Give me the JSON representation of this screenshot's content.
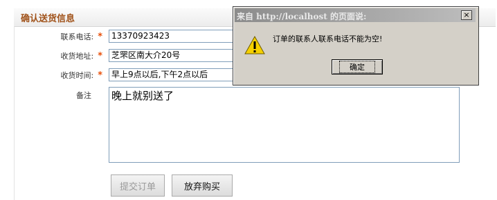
{
  "header": {
    "title": "确认送货信息"
  },
  "form": {
    "phone": {
      "label": "联系电话:",
      "required_mark": "*",
      "value": "13370923423"
    },
    "address": {
      "label": "收货地址:",
      "required_mark": "*",
      "value": "芝罘区南大介20号"
    },
    "delivery_time": {
      "label": "收货时间:",
      "required_mark": "*",
      "value": "早上9点以后,下午2点以后"
    },
    "notes": {
      "label": "备注",
      "value": "晚上就别送了"
    }
  },
  "buttons": {
    "submit_label": "提交订单",
    "cancel_label": "放弃购买"
  },
  "dialog": {
    "title": "来自 http://localhost 的页面说:",
    "close_glyph": "×",
    "message": "订单的联系人联系电话不能为空!",
    "ok_label": "确定",
    "icon": "warning-icon"
  },
  "colors": {
    "header_title": "#a0521a",
    "required": "#e8500a",
    "dialog_bg": "#d4d0c8"
  }
}
